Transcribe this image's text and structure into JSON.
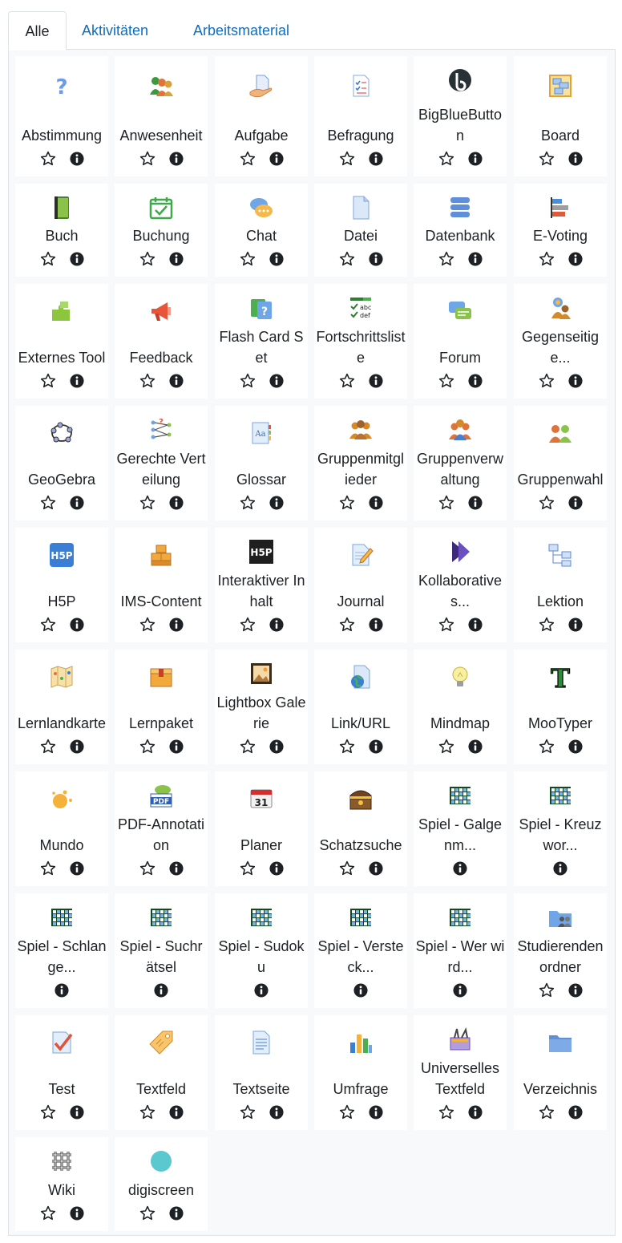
{
  "tabs": [
    {
      "label": "Alle",
      "active": true
    },
    {
      "label": "Aktivitäten",
      "active": false
    },
    {
      "label": "Arbeitsmaterial",
      "active": false
    }
  ],
  "colors": {
    "link": "#0f6cbf",
    "text": "#1d2125",
    "panel_bg": "#f8f9fa",
    "card_bg": "#ffffff"
  },
  "rows": [
    [
      {
        "label": "Abstimmung",
        "icon": "question-icon",
        "star": true
      },
      {
        "label": "Anwesenheit",
        "icon": "people-group-icon",
        "star": true
      },
      {
        "label": "Aufgabe",
        "icon": "assignment-hand-icon",
        "star": true
      },
      {
        "label": "Befragung",
        "icon": "survey-checklist-icon",
        "star": true
      },
      {
        "label": "BigBlueButton",
        "icon": "bigbluebutton-icon",
        "star": true
      },
      {
        "label": "Board",
        "icon": "board-icon",
        "star": true
      }
    ],
    [
      {
        "label": "Buch",
        "icon": "book-icon",
        "star": true
      },
      {
        "label": "Buchung",
        "icon": "calendar-check-icon",
        "star": true
      },
      {
        "label": "Chat",
        "icon": "chat-bubbles-icon",
        "star": true
      },
      {
        "label": "Datei",
        "icon": "file-icon",
        "star": true
      },
      {
        "label": "Datenbank",
        "icon": "database-icon",
        "star": true
      },
      {
        "label": "E-Voting",
        "icon": "bar-chart-horizontal-icon",
        "star": true
      }
    ],
    [
      {
        "label": "Externes Tool",
        "icon": "puzzle-icon",
        "star": true
      },
      {
        "label": "Feedback",
        "icon": "megaphone-icon",
        "star": true
      },
      {
        "label": "Flash Card Set",
        "icon": "flashcard-icon",
        "star": true
      },
      {
        "label": "Fortschrittsliste",
        "icon": "checklist-abc-icon",
        "star": true
      },
      {
        "label": "Forum",
        "icon": "forum-bubbles-icon",
        "star": true
      },
      {
        "label": "Gegenseitige...",
        "icon": "peer-assessment-icon",
        "star": true
      }
    ],
    [
      {
        "label": "GeoGebra",
        "icon": "geogebra-icon",
        "star": true
      },
      {
        "label": "Gerechte Verteilung",
        "icon": "ratingallocate-icon",
        "star": true
      },
      {
        "label": "Glossar",
        "icon": "glossary-icon",
        "star": true
      },
      {
        "label": "Gruppenmitglieder",
        "icon": "group-members-icon",
        "star": true
      },
      {
        "label": "Gruppenverwaltung",
        "icon": "group-management-icon",
        "star": true
      },
      {
        "label": "Gruppenwahl",
        "icon": "group-choice-icon",
        "star": true
      }
    ],
    [
      {
        "label": "H5P",
        "icon": "h5p-blue-icon",
        "star": true
      },
      {
        "label": "IMS-Content",
        "icon": "ims-boxes-icon",
        "star": true
      },
      {
        "label": "Interaktiver Inhalt",
        "icon": "h5p-black-icon",
        "star": true
      },
      {
        "label": "Journal",
        "icon": "journal-pencil-icon",
        "star": true
      },
      {
        "label": "Kollaboratives...",
        "icon": "collaborative-arrow-icon",
        "star": true
      },
      {
        "label": "Lektion",
        "icon": "lesson-tree-icon",
        "star": true
      }
    ],
    [
      {
        "label": "Lernlandkarte",
        "icon": "map-icon",
        "star": true
      },
      {
        "label": "Lernpaket",
        "icon": "package-box-icon",
        "star": true
      },
      {
        "label": "Lightbox Galerie",
        "icon": "picture-frame-icon",
        "star": true
      },
      {
        "label": "Link/URL",
        "icon": "globe-page-icon",
        "star": true
      },
      {
        "label": "Mindmap",
        "icon": "lightbulb-icon",
        "star": true
      },
      {
        "label": "MooTyper",
        "icon": "letter-t-icon",
        "star": true
      }
    ],
    [
      {
        "label": "Mundo",
        "icon": "mundo-dots-icon",
        "star": true
      },
      {
        "label": "PDF-Annotation",
        "icon": "pdf-annotation-icon",
        "star": true
      },
      {
        "label": "Planer",
        "icon": "calendar-31-icon",
        "star": true
      },
      {
        "label": "Schatzsuche",
        "icon": "treasure-chest-icon",
        "star": true
      },
      {
        "label": "Spiel - Galgenm...",
        "icon": "game-grid-icon",
        "star": false
      },
      {
        "label": "Spiel - Kreuzwor...",
        "icon": "game-grid-icon",
        "star": false
      }
    ],
    [
      {
        "label": "Spiel - Schlange...",
        "icon": "game-grid-icon",
        "star": false
      },
      {
        "label": "Spiel - Suchrätsel",
        "icon": "game-grid-icon",
        "star": false
      },
      {
        "label": "Spiel - Sudoku",
        "icon": "game-grid-icon",
        "star": false
      },
      {
        "label": "Spiel - Versteck...",
        "icon": "game-grid-icon",
        "star": false
      },
      {
        "label": "Spiel - Wer wird...",
        "icon": "game-grid-icon",
        "star": false
      },
      {
        "label": "Studierendenordner",
        "icon": "student-folder-icon",
        "star": true
      }
    ],
    [
      {
        "label": "Test",
        "icon": "quiz-check-icon",
        "star": true
      },
      {
        "label": "Textfeld",
        "icon": "label-tag-icon",
        "star": true
      },
      {
        "label": "Textseite",
        "icon": "text-page-icon",
        "star": true
      },
      {
        "label": "Umfrage",
        "icon": "bar-chart-icon",
        "star": true
      },
      {
        "label": "Universelles Textfeld",
        "icon": "unilabel-icon",
        "star": true
      },
      {
        "label": "Verzeichnis",
        "icon": "folder-icon",
        "star": true
      }
    ],
    [
      {
        "label": "Wiki",
        "icon": "wiki-knot-icon",
        "star": true
      },
      {
        "label": "digiscreen",
        "icon": "teal-circle-icon",
        "star": true
      }
    ]
  ]
}
